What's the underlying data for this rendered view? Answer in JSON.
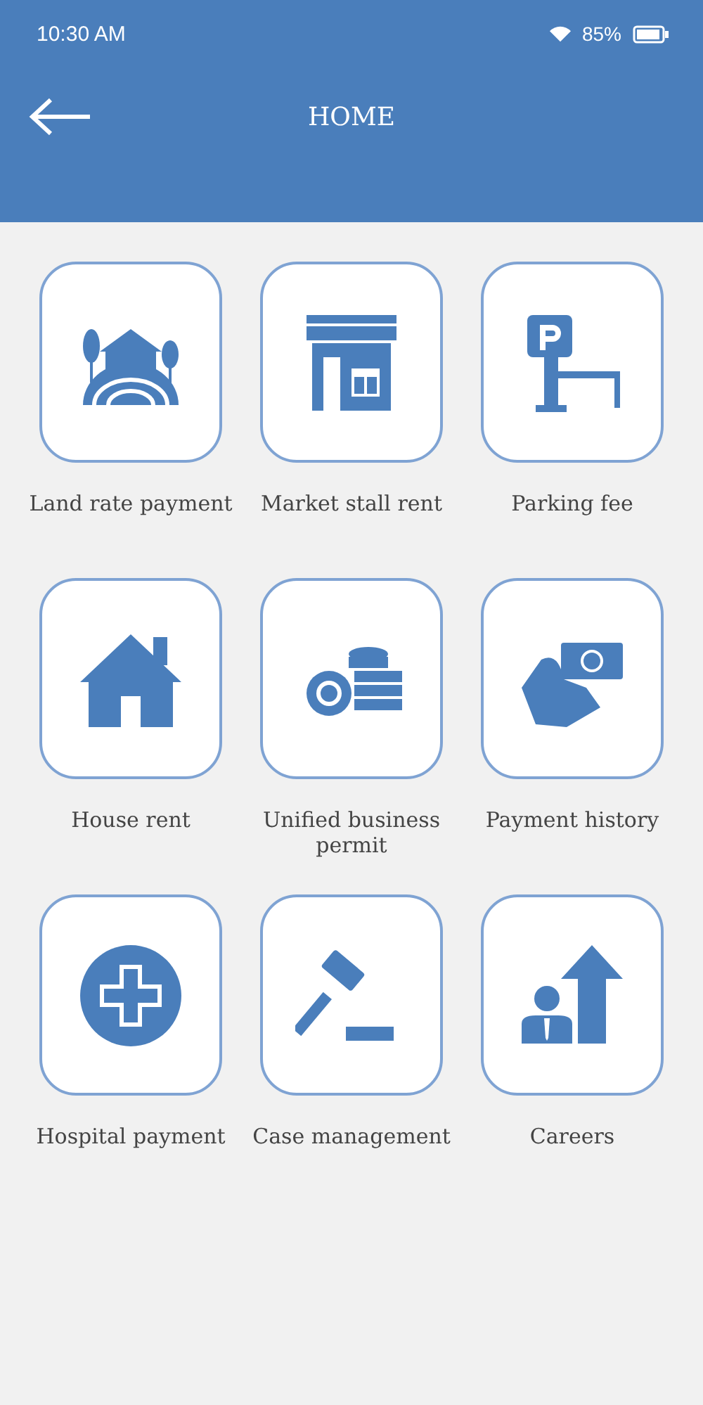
{
  "status_bar": {
    "time": "10:30 AM",
    "battery": "85%"
  },
  "header": {
    "title": "HOME"
  },
  "tiles": [
    {
      "label": "Land rate payment"
    },
    {
      "label": "Market stall rent"
    },
    {
      "label": "Parking fee"
    },
    {
      "label": "House rent"
    },
    {
      "label": "Unified business permit"
    },
    {
      "label": "Payment history"
    },
    {
      "label": "Hospital payment"
    },
    {
      "label": "Case management"
    },
    {
      "label": "Careers"
    }
  ]
}
